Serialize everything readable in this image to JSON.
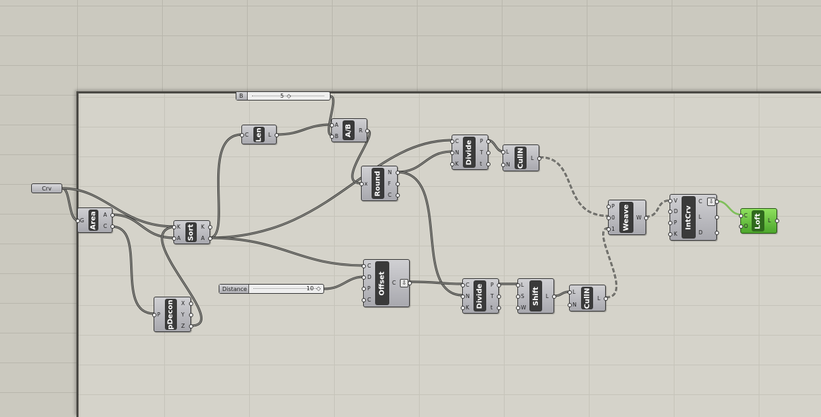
{
  "canvas": {
    "components": {
      "area": {
        "title": "Area",
        "inputs": [
          "G"
        ],
        "outputs": [
          "A",
          "C"
        ]
      },
      "sort": {
        "title": "Sort",
        "inputs": [
          "K",
          "A"
        ],
        "outputs": [
          "K",
          "A"
        ]
      },
      "pdecon": {
        "title": "pDecon",
        "inputs": [
          "P"
        ],
        "outputs": [
          "X",
          "Y",
          "Z"
        ]
      },
      "len": {
        "title": "Len",
        "inputs": [
          "C"
        ],
        "outputs": [
          "L"
        ]
      },
      "div": {
        "title": "A/B",
        "inputs": [
          "A",
          "B"
        ],
        "outputs": [
          "R"
        ]
      },
      "round": {
        "title": "Round",
        "inputs": [
          "x"
        ],
        "outputs": [
          "N",
          "F",
          "C"
        ]
      },
      "divide1": {
        "title": "Divide",
        "inputs": [
          "C",
          "N",
          "K"
        ],
        "outputs": [
          "P",
          "T",
          "t"
        ]
      },
      "culln1": {
        "title": "CullN",
        "inputs": [
          "L",
          "N"
        ],
        "outputs": [
          "L"
        ]
      },
      "offset": {
        "title": "Offset",
        "inputs": [
          "C",
          "D",
          "P",
          "C"
        ],
        "outputs": [
          "C"
        ]
      },
      "divide2": {
        "title": "Divide",
        "inputs": [
          "C",
          "N",
          "K"
        ],
        "outputs": [
          "P",
          "T",
          "t"
        ]
      },
      "shift": {
        "title": "Shift",
        "inputs": [
          "L",
          "S",
          "W"
        ],
        "outputs": [
          "L"
        ]
      },
      "culln2": {
        "title": "CullN",
        "inputs": [
          "L",
          "N"
        ],
        "outputs": [
          "L"
        ]
      },
      "weave": {
        "title": "Weave",
        "inputs": [
          "P",
          "0",
          "1"
        ],
        "outputs": [
          "W"
        ]
      },
      "intcrv": {
        "title": "IntCrv",
        "inputs": [
          "V",
          "D",
          "P",
          "K"
        ],
        "outputs": [
          "C",
          "L",
          "D"
        ]
      },
      "loft": {
        "title": "Loft",
        "inputs": [
          "C",
          "O"
        ],
        "outputs": [
          "L"
        ]
      }
    },
    "params": {
      "crv": {
        "label": "Crv"
      }
    },
    "sliders": {
      "b": {
        "label": "B",
        "value": "5"
      },
      "distance": {
        "label": "Distance",
        "value": "10"
      }
    },
    "icons": {
      "flatten": "down-arrow-icon",
      "slider_knob": "diamond-icon"
    },
    "colors": {
      "canvas_outer": "#cbc9bf",
      "canvas_inner": "#d5d3ca",
      "component": "#b4b4b9",
      "component_core": "#3a3a3a",
      "loft_green": "#5cbf3a",
      "wire": "#3e3e3c"
    }
  }
}
